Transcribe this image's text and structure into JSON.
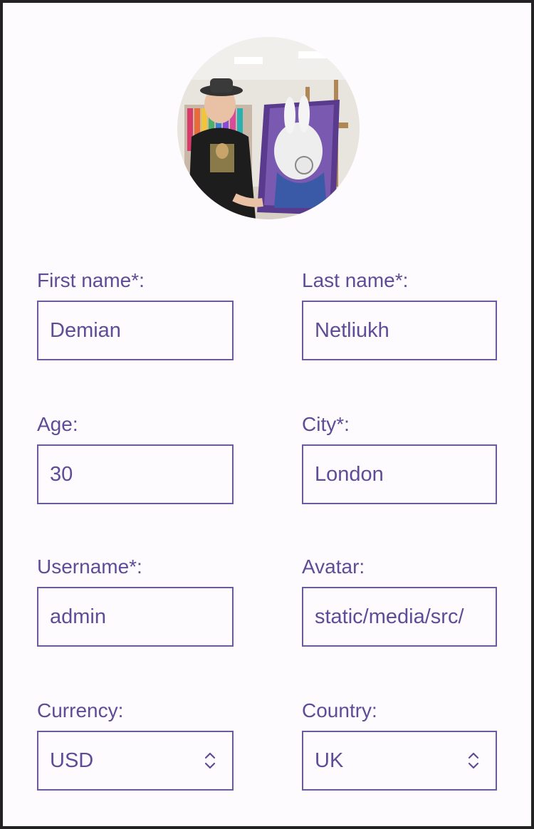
{
  "avatar": {
    "alt": "Profile photo"
  },
  "form": {
    "first_name": {
      "label": "First name*:",
      "value": "Demian"
    },
    "last_name": {
      "label": "Last name*:",
      "value": "Netliukh"
    },
    "age": {
      "label": "Age:",
      "value": "30"
    },
    "city": {
      "label": "City*:",
      "value": "London"
    },
    "username": {
      "label": "Username*:",
      "value": "admin"
    },
    "avatar": {
      "label": "Avatar:",
      "value": "static/media/src/"
    },
    "currency": {
      "label": "Currency:",
      "value": "USD"
    },
    "country": {
      "label": "Country:",
      "value": "UK"
    }
  },
  "colors": {
    "accent": "#5f4c98",
    "border": "#6a5aa0",
    "background": "#fdfbfd"
  },
  "icons": {
    "select_arrow": "chevron-up-down-icon"
  }
}
